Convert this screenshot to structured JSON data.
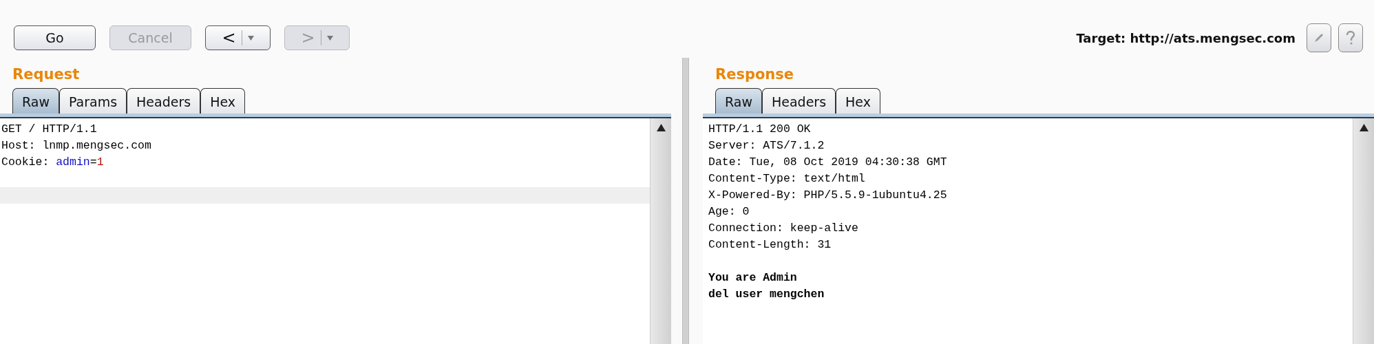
{
  "toolbar": {
    "buttons": [
      {
        "kind": "text",
        "label": "Go",
        "disabled": false
      },
      {
        "kind": "text",
        "label": "Cancel",
        "disabled": true
      },
      {
        "kind": "nav",
        "label": "<",
        "disabled": false
      },
      {
        "kind": "nav",
        "label": ">",
        "disabled": true
      }
    ],
    "target": "Target: http://ats.mengsec.com"
  },
  "panes": [
    {
      "title": "Request",
      "tabs": [
        {
          "label": "Raw",
          "selected": true
        },
        {
          "label": "Params",
          "selected": false
        },
        {
          "label": "Headers",
          "selected": false
        },
        {
          "label": "Hex",
          "selected": false
        }
      ],
      "lines": [
        {
          "segments": [
            {
              "kind": "text",
              "text": "GET / HTTP/1.1"
            }
          ]
        },
        {
          "segments": [
            {
              "kind": "text",
              "text": "Host: lnmp.mengsec.com"
            }
          ]
        },
        {
          "segments": [
            {
              "kind": "text",
              "text": "Cookie: "
            },
            {
              "kind": "param_name",
              "text": "admin"
            },
            {
              "kind": "text",
              "text": "="
            },
            {
              "kind": "param_value",
              "text": "1"
            }
          ]
        }
      ]
    },
    {
      "title": "Response",
      "tabs": [
        {
          "label": "Raw",
          "selected": true
        },
        {
          "label": "Headers",
          "selected": false
        },
        {
          "label": "Hex",
          "selected": false
        }
      ],
      "lines": [
        {
          "segments": [
            {
              "kind": "text",
              "text": "HTTP/1.1 200 OK"
            }
          ]
        },
        {
          "segments": [
            {
              "kind": "text",
              "text": "Server: ATS/7.1.2"
            }
          ]
        },
        {
          "segments": [
            {
              "kind": "text",
              "text": "Date: Tue, 08 Oct 2019 04:30:38 GMT"
            }
          ]
        },
        {
          "segments": [
            {
              "kind": "text",
              "text": "Content-Type: text/html"
            }
          ]
        },
        {
          "segments": [
            {
              "kind": "text",
              "text": "X-Powered-By: PHP/5.5.9-1ubuntu4.25"
            }
          ]
        },
        {
          "segments": [
            {
              "kind": "text",
              "text": "Age: 0"
            }
          ]
        },
        {
          "segments": [
            {
              "kind": "text",
              "text": "Connection: keep-alive"
            }
          ]
        },
        {
          "segments": [
            {
              "kind": "text",
              "text": "Content-Length: 31"
            }
          ]
        },
        {
          "segments": [
            {
              "kind": "blank"
            }
          ]
        },
        {
          "segments": [
            {
              "kind": "body",
              "text": "You are Admin"
            }
          ]
        },
        {
          "segments": [
            {
              "kind": "body",
              "text": "del user mengchen"
            }
          ]
        }
      ]
    }
  ]
}
